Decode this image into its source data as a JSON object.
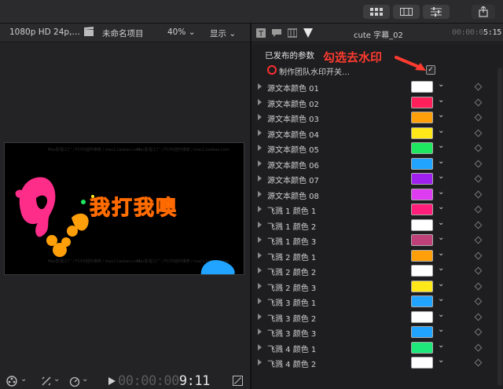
{
  "toolbar": {
    "buttons": [
      "grid-view",
      "filmstrip-view",
      "inspector-toggle",
      "share"
    ]
  },
  "viewer": {
    "format": "1080p HD 24p,…",
    "project": "未命名项目",
    "zoom": "40%",
    "display": "显示",
    "canvas_title": "我打我噢",
    "timecode_dim": "00:00:00",
    "timecode_bright": "9:11"
  },
  "inspector": {
    "title": "cute 字幕_02",
    "time_dim": "00:00:0",
    "time_bright": "5:15",
    "section": "已发布的参数",
    "annotation": "勾选去水印",
    "watermark_label": "制作团队水印开关…",
    "watermark_checked": "✓",
    "chevron": "⌄",
    "params": [
      {
        "label": "源文本颜色 01",
        "color": "#ffffff"
      },
      {
        "label": "源文本颜色 02",
        "color": "#ff1f5a"
      },
      {
        "label": "源文本颜色 03",
        "color": "#ff9f0a"
      },
      {
        "label": "源文本颜色 04",
        "color": "#ffe81a"
      },
      {
        "label": "源文本颜色 05",
        "color": "#1ee85f"
      },
      {
        "label": "源文本颜色 06",
        "color": "#20a4ff"
      },
      {
        "label": "源文本颜色 07",
        "color": "#a020f0"
      },
      {
        "label": "源文本颜色 08",
        "color": "#dd3cf0"
      },
      {
        "label": "飞溅 1 颜色 1",
        "color": "#ff1f7a"
      },
      {
        "label": "飞溅 1 颜色 2",
        "color": "#ffffff"
      },
      {
        "label": "飞溅 1 颜色 3",
        "color": "#c0407a"
      },
      {
        "label": "飞溅 2 颜色 1",
        "color": "#ff9f0a"
      },
      {
        "label": "飞溅 2 颜色 2",
        "color": "#ffffff"
      },
      {
        "label": "飞溅 2 颜色 3",
        "color": "#ffe81a"
      },
      {
        "label": "飞溅 3 颜色 1",
        "color": "#20a4ff"
      },
      {
        "label": "飞溅 3 颜色 2",
        "color": "#ffffff"
      },
      {
        "label": "飞溅 3 颜色 3",
        "color": "#20a4ff"
      },
      {
        "label": "飞溅 4 颜色 1",
        "color": "#1ee87a"
      },
      {
        "label": "飞溅 4 颜色 2",
        "color": "#ffffff"
      }
    ]
  },
  "watermark_texts": [
    "Mac影视工厂 / FCPX插件推荐 / mac1.taobao.com"
  ]
}
